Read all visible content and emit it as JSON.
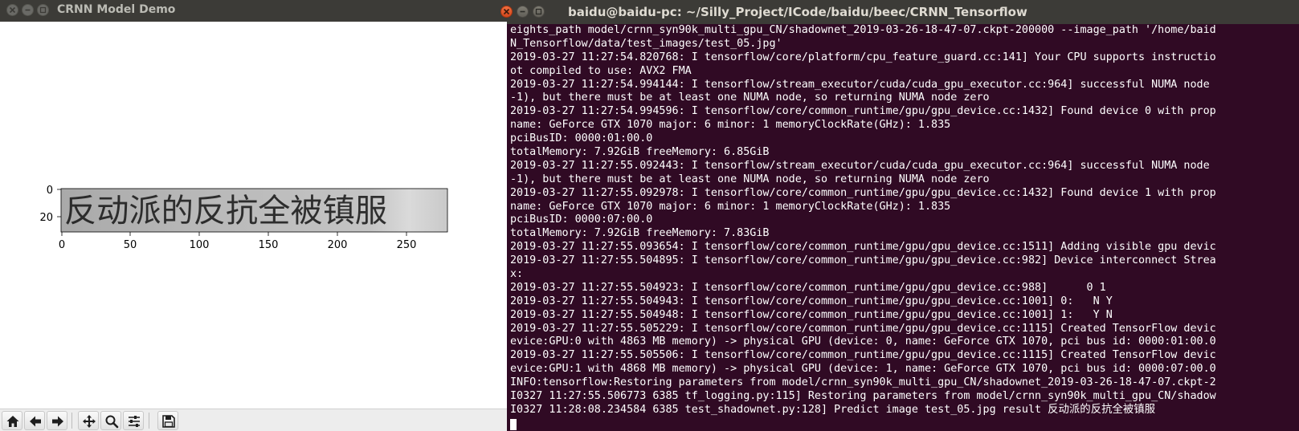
{
  "left_window": {
    "title": "CRNN Model Demo",
    "plot": {
      "image_text": "反动派的反抗全被镇服",
      "y_ticks": [
        "0",
        "20"
      ],
      "x_ticks": [
        "0",
        "50",
        "100",
        "150",
        "200",
        "250"
      ]
    },
    "toolbar": {
      "buttons": [
        {
          "name": "home-button",
          "icon": "home-icon"
        },
        {
          "name": "back-button",
          "icon": "arrow-left-icon"
        },
        {
          "name": "forward-button",
          "icon": "arrow-right-icon"
        },
        {
          "name": "pan-button",
          "icon": "move-icon"
        },
        {
          "name": "zoom-button",
          "icon": "magnifier-icon"
        },
        {
          "name": "subplots-button",
          "icon": "sliders-icon"
        },
        {
          "name": "save-button",
          "icon": "floppy-icon"
        }
      ]
    }
  },
  "right_window": {
    "title": "baidu@baidu-pc: ~/Silly_Project/ICode/baidu/beec/CRNN_Tensorflow",
    "terminal_lines": [
      "eights_path model/crnn_syn90k_multi_gpu_CN/shadownet_2019-03-26-18-47-07.ckpt-200000 --image_path '/home/baid",
      "N_Tensorflow/data/test_images/test_05.jpg'",
      "2019-03-27 11:27:54.820768: I tensorflow/core/platform/cpu_feature_guard.cc:141] Your CPU supports instructio",
      "ot compiled to use: AVX2 FMA",
      "2019-03-27 11:27:54.994144: I tensorflow/stream_executor/cuda/cuda_gpu_executor.cc:964] successful NUMA node ",
      "-1), but there must be at least one NUMA node, so returning NUMA node zero",
      "2019-03-27 11:27:54.994596: I tensorflow/core/common_runtime/gpu/gpu_device.cc:1432] Found device 0 with prop",
      "name: GeForce GTX 1070 major: 6 minor: 1 memoryClockRate(GHz): 1.835",
      "pciBusID: 0000:01:00.0",
      "totalMemory: 7.92GiB freeMemory: 6.85GiB",
      "2019-03-27 11:27:55.092443: I tensorflow/stream_executor/cuda/cuda_gpu_executor.cc:964] successful NUMA node ",
      "-1), but there must be at least one NUMA node, so returning NUMA node zero",
      "2019-03-27 11:27:55.092978: I tensorflow/core/common_runtime/gpu/gpu_device.cc:1432] Found device 1 with prop",
      "name: GeForce GTX 1070 major: 6 minor: 1 memoryClockRate(GHz): 1.835",
      "pciBusID: 0000:07:00.0",
      "totalMemory: 7.92GiB freeMemory: 7.83GiB",
      "2019-03-27 11:27:55.093654: I tensorflow/core/common_runtime/gpu/gpu_device.cc:1511] Adding visible gpu devic",
      "2019-03-27 11:27:55.504895: I tensorflow/core/common_runtime/gpu/gpu_device.cc:982] Device interconnect Strea",
      "x:",
      "2019-03-27 11:27:55.504923: I tensorflow/core/common_runtime/gpu/gpu_device.cc:988]      0 1",
      "2019-03-27 11:27:55.504943: I tensorflow/core/common_runtime/gpu/gpu_device.cc:1001] 0:   N Y",
      "2019-03-27 11:27:55.504948: I tensorflow/core/common_runtime/gpu/gpu_device.cc:1001] 1:   Y N",
      "2019-03-27 11:27:55.505229: I tensorflow/core/common_runtime/gpu/gpu_device.cc:1115] Created TensorFlow devic",
      "evice:GPU:0 with 4863 MB memory) -> physical GPU (device: 0, name: GeForce GTX 1070, pci bus id: 0000:01:00.0",
      "2019-03-27 11:27:55.505506: I tensorflow/core/common_runtime/gpu/gpu_device.cc:1115] Created TensorFlow devic",
      "evice:GPU:1 with 4868 MB memory) -> physical GPU (device: 1, name: GeForce GTX 1070, pci bus id: 0000:07:00.0",
      "INFO:tensorflow:Restoring parameters from model/crnn_syn90k_multi_gpu_CN/shadownet_2019-03-26-18-47-07.ckpt-2",
      "I0327 11:27:55.506773 6385 tf_logging.py:115] Restoring parameters from model/crnn_syn90k_multi_gpu_CN/shadow",
      "I0327 11:28:08.234584 6385 test_shadownet.py:128] Predict image test_05.jpg result 反动派的反抗全被镇服"
    ]
  },
  "colors": {
    "terminal_bg": "#300a24",
    "terminal_fg": "#ffffff",
    "titlebar": "#3c3b37",
    "close_button": "#e9541f"
  }
}
